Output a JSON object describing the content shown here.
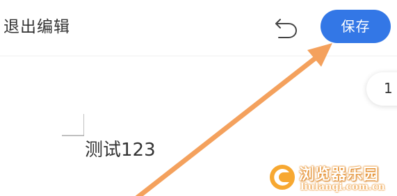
{
  "toolbar": {
    "exit_label": "退出编辑",
    "undo_icon": "undo-icon",
    "save_label": "保存",
    "save_color": "#3377e6"
  },
  "page_indicator": {
    "value": "1"
  },
  "document": {
    "text": "测试123"
  },
  "annotation": {
    "arrow_color": "#f4a15d"
  },
  "watermark": {
    "title": "浏览器乐园",
    "url": "liulanqi.com.cn",
    "color": "#f39a2c"
  }
}
